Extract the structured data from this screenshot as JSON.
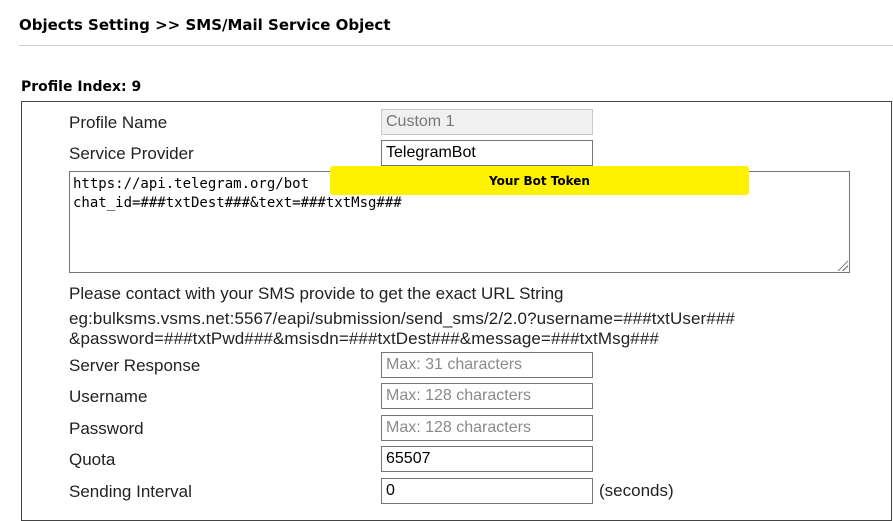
{
  "header": {
    "title": "Objects Setting >> SMS/Mail Service Object"
  },
  "profile": {
    "index_label": "Profile Index: 9"
  },
  "form": {
    "profile_name": {
      "label": "Profile Name",
      "value": "Custom 1"
    },
    "service_provider": {
      "label": "Service Provider",
      "value": "TelegramBot"
    },
    "url_string": {
      "value": "https://api.telegram.org/bot                                      /sendMessage?chat_id=###txtDest###&text=###txtMsg###"
    },
    "token_overlay": "Your Bot Token",
    "note": "Please contact with your SMS provide to get the exact URL String",
    "example_line1": "eg:bulksms.vsms.net:5567/eapi/submission/send_sms/2/2.0?username=###txtUser###",
    "example_line2": "&password=###txtPwd###&msisdn=###txtDest###&message=###txtMsg###",
    "server_response": {
      "label": "Server Response",
      "placeholder": "Max: 31 characters"
    },
    "username": {
      "label": "Username",
      "placeholder": "Max: 128 characters"
    },
    "password": {
      "label": "Password",
      "placeholder": "Max: 128 characters"
    },
    "quota": {
      "label": "Quota",
      "value": "65507"
    },
    "sending_interval": {
      "label": "Sending Interval",
      "value": "0",
      "suffix": "(seconds)"
    }
  }
}
